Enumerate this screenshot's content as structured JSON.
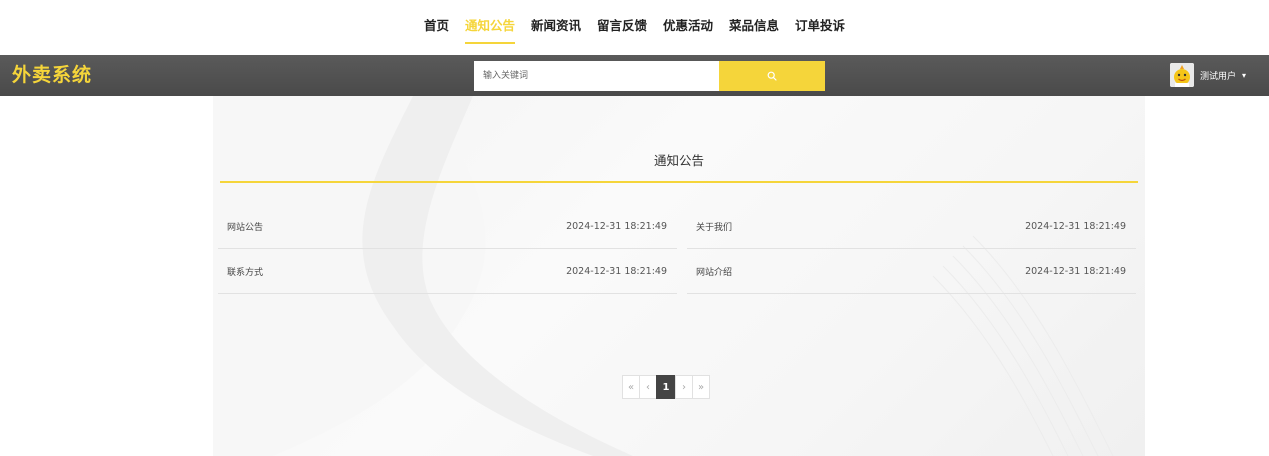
{
  "nav": {
    "items": [
      {
        "label": "首页",
        "active": false
      },
      {
        "label": "通知公告",
        "active": true
      },
      {
        "label": "新闻资讯",
        "active": false
      },
      {
        "label": "留言反馈",
        "active": false
      },
      {
        "label": "优惠活动",
        "active": false
      },
      {
        "label": "菜品信息",
        "active": false
      },
      {
        "label": "订单投诉",
        "active": false
      }
    ]
  },
  "header": {
    "logo": "外卖系统",
    "search": {
      "placeholder": "输入关键词"
    },
    "user": {
      "name": "测试用户",
      "caret": "▾"
    }
  },
  "main": {
    "title": "通知公告",
    "notices": [
      {
        "title": "网站公告",
        "time": "2024-12-31 18:21:49"
      },
      {
        "title": "关于我们",
        "time": "2024-12-31 18:21:49"
      },
      {
        "title": "联系方式",
        "time": "2024-12-31 18:21:49"
      },
      {
        "title": "网站介绍",
        "time": "2024-12-31 18:21:49"
      }
    ],
    "pagination": {
      "first": "«",
      "prev": "‹",
      "current": "1",
      "next": "›",
      "last": "»"
    }
  },
  "colors": {
    "accent": "#f5d53a",
    "header_bg": "#4f4f4f",
    "page_current_bg": "#444444"
  },
  "icons": {
    "search": "search-icon",
    "avatar": "user-avatar-icon",
    "caret": "caret-down-icon"
  }
}
